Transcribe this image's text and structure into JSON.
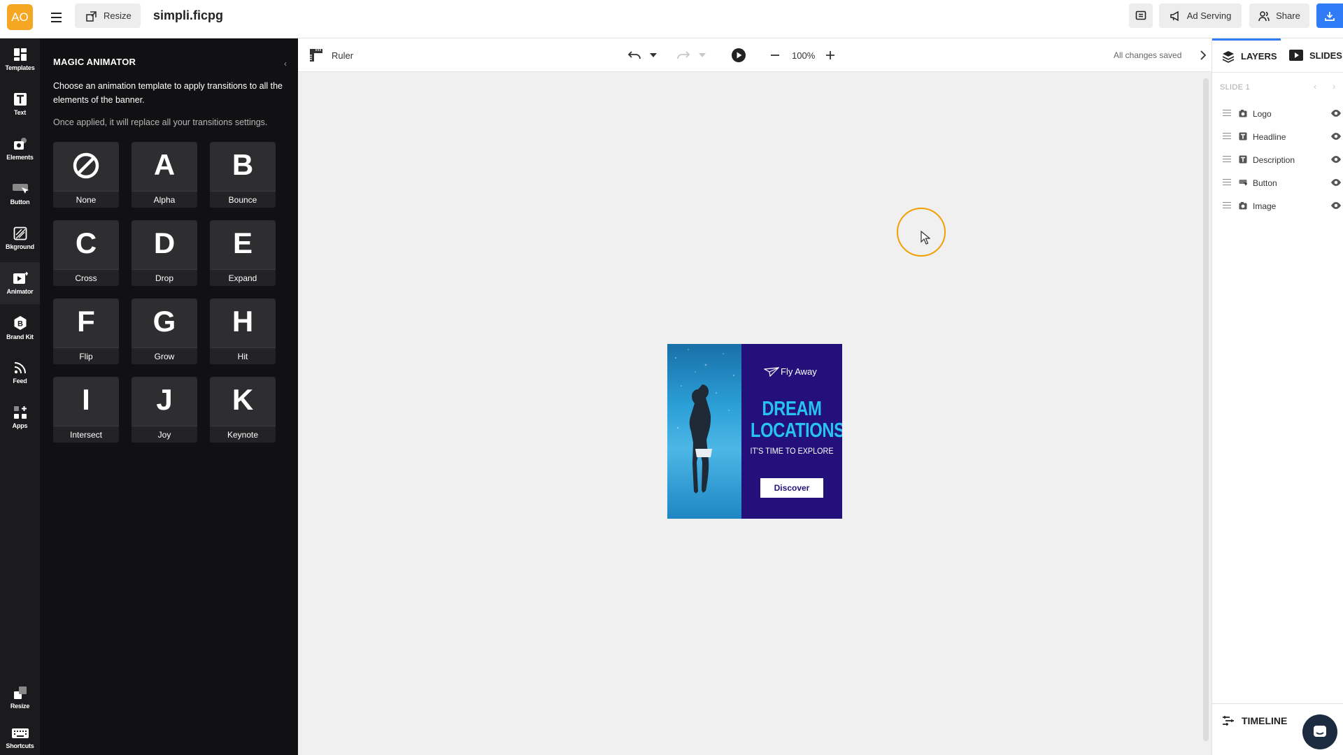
{
  "topbar": {
    "avatar_initials": "AO",
    "resize_label": "Resize",
    "doc_title": "simpli.ficpg",
    "ad_serving_label": "Ad Serving",
    "share_label": "Share"
  },
  "rail": [
    {
      "label": "Templates",
      "icon": "templates-icon"
    },
    {
      "label": "Text",
      "icon": "text-icon"
    },
    {
      "label": "Elements",
      "icon": "elements-icon"
    },
    {
      "label": "Button",
      "icon": "button-icon"
    },
    {
      "label": "Bkground",
      "icon": "background-icon"
    },
    {
      "label": "Animator",
      "icon": "animator-icon"
    },
    {
      "label": "Brand Kit",
      "icon": "brand-kit-icon"
    },
    {
      "label": "Feed",
      "icon": "feed-icon"
    },
    {
      "label": "Apps",
      "icon": "apps-icon"
    },
    {
      "label": "Resize",
      "icon": "resize-icon"
    },
    {
      "label": "Shortcuts",
      "icon": "keyboard-icon"
    }
  ],
  "animator": {
    "title": "MAGIC ANIMATOR",
    "description": "Choose an animation template to apply transitions to all the elements of the banner.",
    "note": "Once applied, it will replace all your transitions settings.",
    "templates": [
      {
        "letter": "⊘",
        "name": "None"
      },
      {
        "letter": "A",
        "name": "Alpha"
      },
      {
        "letter": "B",
        "name": "Bounce"
      },
      {
        "letter": "C",
        "name": "Cross"
      },
      {
        "letter": "D",
        "name": "Drop"
      },
      {
        "letter": "E",
        "name": "Expand"
      },
      {
        "letter": "F",
        "name": "Flip"
      },
      {
        "letter": "G",
        "name": "Grow"
      },
      {
        "letter": "H",
        "name": "Hit"
      },
      {
        "letter": "I",
        "name": "Intersect"
      },
      {
        "letter": "J",
        "name": "Joy"
      },
      {
        "letter": "K",
        "name": "Keynote"
      }
    ]
  },
  "canvas_bar": {
    "ruler_label": "Ruler",
    "zoom": "100%",
    "status": "All changes saved"
  },
  "banner": {
    "logo_text": "Fly Away",
    "headline_line1": "DREAM",
    "headline_line2": "LOCATIONS",
    "description": "IT'S TIME TO EXPLORE",
    "button_label": "Discover",
    "background_color": "#23107a",
    "headline_color": "#27c3f0"
  },
  "right_panel": {
    "layers_tab": "LAYERS",
    "slides_tab": "SLIDES",
    "slide_label": "SLIDE 1",
    "layers": [
      {
        "name": "Logo",
        "icon": "image-icon"
      },
      {
        "name": "Headline",
        "icon": "text-icon"
      },
      {
        "name": "Description",
        "icon": "text-icon"
      },
      {
        "name": "Button",
        "icon": "button-icon"
      },
      {
        "name": "Image",
        "icon": "image-icon"
      }
    ],
    "timeline_label": "TIMELINE"
  },
  "colors": {
    "accent": "#2f7cf6",
    "avatar": "#f5a623",
    "cursor_ring": "#f0a000"
  }
}
